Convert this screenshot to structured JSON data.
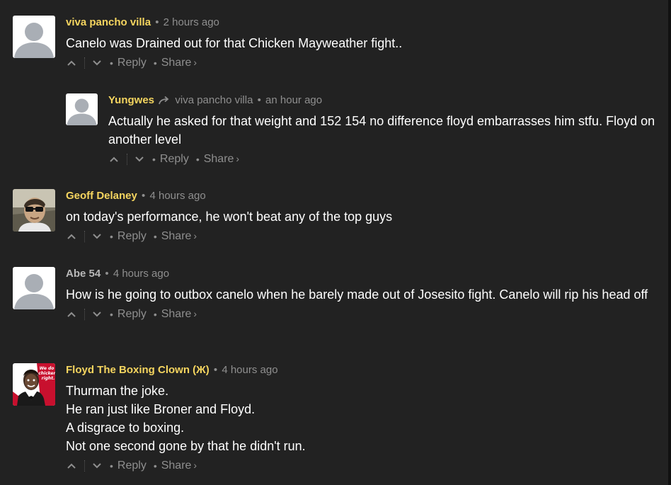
{
  "colors": {
    "background": "#222222",
    "author": "#f5d55f",
    "meta": "#8f8f8f",
    "text": "#ffffff"
  },
  "actions": {
    "reply_label": "Reply",
    "share_label": "Share",
    "share_chevron": "›",
    "separator": "•"
  },
  "comments": [
    {
      "author": "viva pancho villa",
      "time": "2 hours ago",
      "avatar": "default-avatar",
      "lines": [
        "Canelo was Drained out for that Chicken Mayweather fight.."
      ]
    },
    {
      "author": "Yungwes",
      "reply_to": "viva pancho villa",
      "time": "an hour ago",
      "avatar": "default-avatar",
      "lines": [
        "Actually he asked for that weight and 152 154 no difference floyd embarrasses him stfu. Floyd on another level"
      ]
    },
    {
      "author": "Geoff Delaney",
      "time": "4 hours ago",
      "avatar": "photo-avatar",
      "lines": [
        "on today's performance, he won't beat any of the top guys"
      ]
    },
    {
      "author": "Abe 54",
      "time": "4 hours ago",
      "avatar": "default-avatar",
      "lines": [
        "How is he going to outbox canelo when he barely made out of Josesito fight. Canelo will rip his head off"
      ]
    },
    {
      "author": "Floyd The Boxing Clown (Ж)",
      "time": "4 hours ago",
      "avatar": "kfc-parody-avatar",
      "avatar_caption": "We do chicken right.",
      "lines": [
        "Thurman the joke.",
        "He ran just like Broner and Floyd.",
        "A disgrace to boxing.",
        "Not one second gone by that he didn't run."
      ]
    }
  ]
}
